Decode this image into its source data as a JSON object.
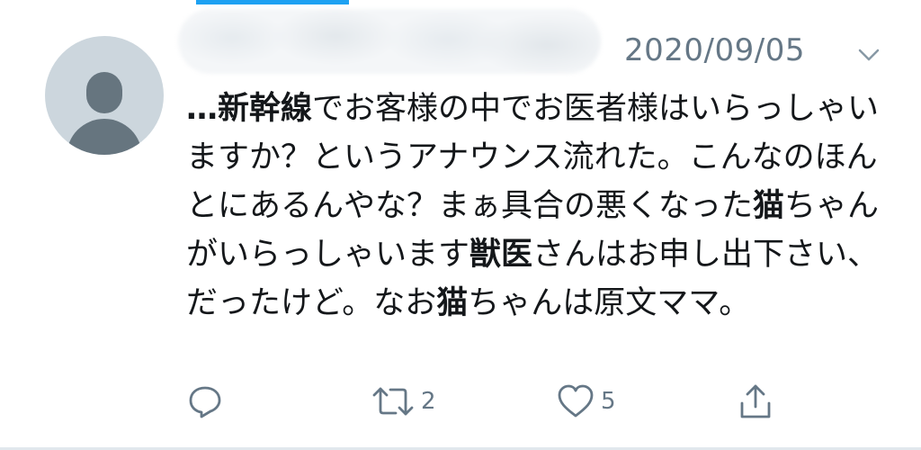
{
  "tweet": {
    "date": "2020/09/05",
    "segments": [
      {
        "t": "…新幹線",
        "b": true
      },
      {
        "t": "でお客様の中でお医者様はいらっしゃいますか？というアナウンス流れた。こんなのほんとにあるんやな？まぁ具合の悪くなった",
        "b": false
      },
      {
        "t": "猫",
        "b": true
      },
      {
        "t": "ちゃんがいらっしゃいます",
        "b": false
      },
      {
        "t": "獣医",
        "b": true
      },
      {
        "t": "さんはお申し出下さい、だったけど。なお",
        "b": false
      },
      {
        "t": "猫",
        "b": true
      },
      {
        "t": "ちゃんは原文ママ。",
        "b": false
      }
    ]
  },
  "actions": {
    "retweet_count": "2",
    "like_count": "5"
  },
  "icons": {
    "reply": "reply-icon",
    "retweet": "retweet-icon",
    "like": "heart-icon",
    "share": "share-icon",
    "more": "chevron-down-icon"
  },
  "colors": {
    "accent": "#1da1f2",
    "muted": "#657786",
    "text": "#14171a",
    "avatar_bg": "#ccd6dd"
  }
}
